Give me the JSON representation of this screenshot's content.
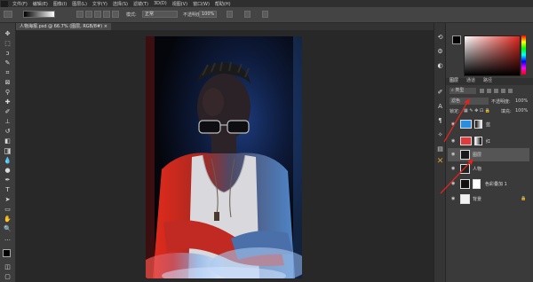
{
  "menubar": {
    "items": [
      "文件(F)",
      "编辑(E)",
      "图像(I)",
      "图层(L)",
      "文字(Y)",
      "选择(S)",
      "滤镜(T)",
      "3D(D)",
      "视图(V)",
      "窗口(W)",
      "帮助(H)"
    ]
  },
  "options": {
    "mode_label": "模式:",
    "mode_value": "正常",
    "opacity_label": "不透明度:",
    "opacity_value": "100%"
  },
  "document": {
    "tab_title": "人物海报.psd @ 66.7% (图层, RGB/8#) ×"
  },
  "panels": {
    "tab_layers": "图层",
    "tab_channels": "通道",
    "tab_paths": "路径",
    "filter_label": "类型",
    "blend_value": "滤色",
    "opacity_label": "不透明度:",
    "opacity_value": "100%",
    "lock_label": "锁定:",
    "fill_label": "填充:",
    "fill_value": "100%"
  },
  "layers": [
    {
      "name": "蓝",
      "thumb": "#2a8ee0"
    },
    {
      "name": "红",
      "thumb": "#e03a3a"
    },
    {
      "name": "图层",
      "thumb": "#1a1a1a"
    },
    {
      "name": "人物",
      "thumb": "#222222"
    },
    {
      "name": "色彩叠加 1",
      "thumb": "#111111"
    },
    {
      "name": "背景",
      "thumb": "#f2f2f2"
    }
  ],
  "colors": {
    "accent_red": "#e0251c",
    "canvas_bg": "#282828"
  }
}
